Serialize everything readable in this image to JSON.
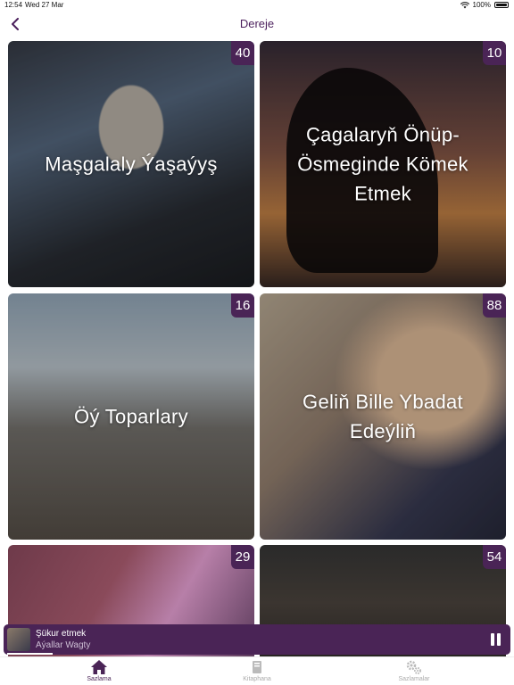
{
  "status": {
    "time": "12:54",
    "date": "Wed 27 Mar",
    "battery": "100%"
  },
  "nav": {
    "title": "Dereje"
  },
  "cards": [
    {
      "title": "Maşgalaly Ýaşaýyş",
      "count": "40"
    },
    {
      "title": "Çagalaryň Önüp-Ösmeginde Kömek Etmek",
      "count": "10"
    },
    {
      "title": "Öý Toparlary",
      "count": "16"
    },
    {
      "title": "Geliň Bille Ybadat Edeýliň",
      "count": "88"
    },
    {
      "title": "",
      "count": "29"
    },
    {
      "title": "",
      "count": "54"
    }
  ],
  "player": {
    "title": "Şükur etmek",
    "subtitle": "Aýallar Wagty",
    "progress": 0.09
  },
  "tabs": [
    {
      "label": "Sazlama",
      "icon": "home-icon",
      "active": true
    },
    {
      "label": "Kitaphana",
      "icon": "book-icon",
      "active": false
    },
    {
      "label": "Sazlamalar",
      "icon": "gears-icon",
      "active": false
    }
  ],
  "colors": {
    "accent": "#4a2456",
    "nav_title": "#4b1f5c"
  }
}
